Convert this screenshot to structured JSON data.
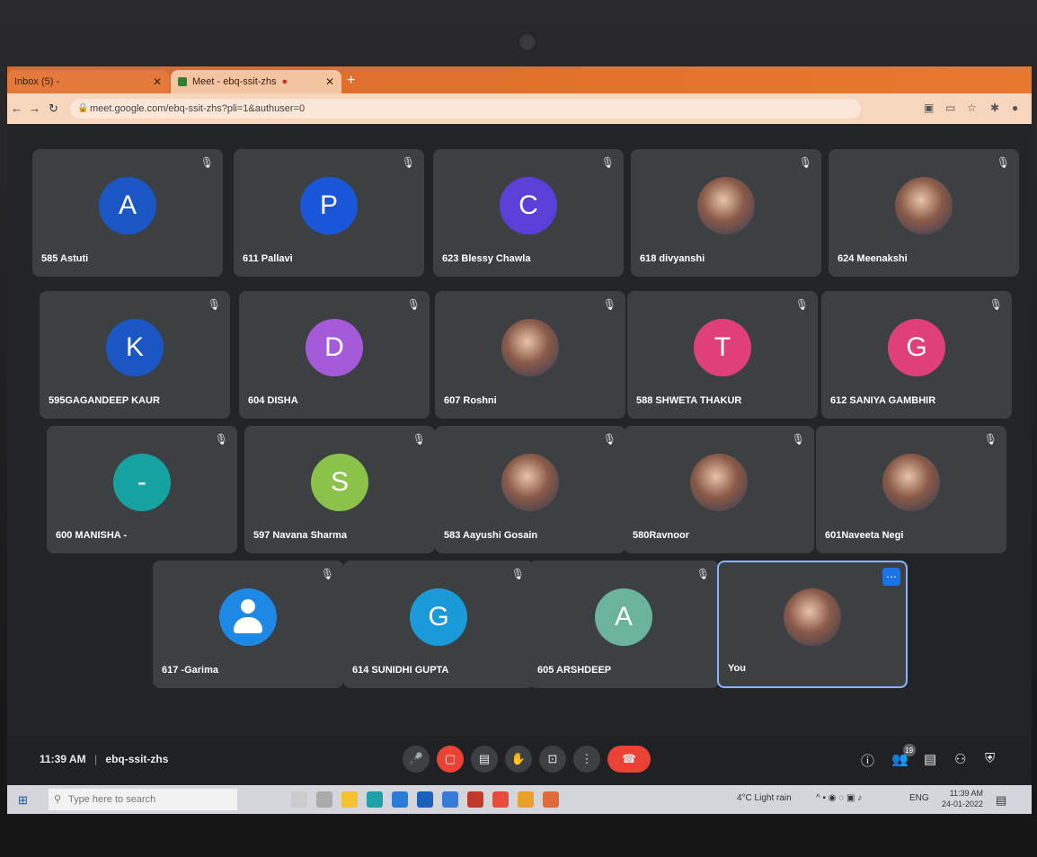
{
  "browser": {
    "tab1_title": "Inbox (5) - ",
    "tab2_title": "Meet - ebq-ssit-zhs",
    "url": "meet.google.com/ebq-ssit-zhs?pli=1&authuser=0"
  },
  "participants": [
    {
      "name": "585 Astuti",
      "initial": "A",
      "color": "#1a56c4",
      "kind": "letter"
    },
    {
      "name": "611 Pallavi",
      "initial": "P",
      "color": "#1a56d8",
      "kind": "letter"
    },
    {
      "name": "623 Blessy Chawla",
      "initial": "C",
      "color": "#5b3fd9",
      "kind": "letter"
    },
    {
      "name": "618 divyanshi",
      "initial": "",
      "color": "#3d6fa8",
      "kind": "photo"
    },
    {
      "name": "624 Meenakshi",
      "initial": "",
      "color": "#b0b8c8",
      "kind": "photo"
    },
    {
      "name": "595GAGANDEEP KAUR",
      "initial": "K",
      "color": "#1a56c4",
      "kind": "letter"
    },
    {
      "name": "604 DISHA",
      "initial": "D",
      "color": "#a55bd9",
      "kind": "letter"
    },
    {
      "name": "607 Roshni",
      "initial": "",
      "color": "#6a4a40",
      "kind": "photo"
    },
    {
      "name": "588 SHWETA THAKUR",
      "initial": "T",
      "color": "#e0407a",
      "kind": "letter"
    },
    {
      "name": "612 SANIYA GAMBHIR",
      "initial": "G",
      "color": "#e0407a",
      "kind": "letter"
    },
    {
      "name": "600 MANISHA -",
      "initial": "-",
      "color": "#17a2a2",
      "kind": "letter"
    },
    {
      "name": "597 Navana Sharma",
      "initial": "S",
      "color": "#8bc34a",
      "kind": "letter"
    },
    {
      "name": "583 Aayushi Gosain",
      "initial": "",
      "color": "#6a4a40",
      "kind": "photo"
    },
    {
      "name": "580Ravnoor",
      "initial": "",
      "color": "#d0b0a0",
      "kind": "photo"
    },
    {
      "name": "601Naveeta Negi",
      "initial": "",
      "color": "#4aa3c8",
      "kind": "photo"
    },
    {
      "name": "617 -Garima",
      "initial": "",
      "color": "#1e88e5",
      "kind": "person"
    },
    {
      "name": "614 SUNIDHI GUPTA",
      "initial": "G",
      "color": "#1a9ad8",
      "kind": "letter"
    },
    {
      "name": "605 ARSHDEEP",
      "initial": "A",
      "color": "#6bb39a",
      "kind": "letter"
    },
    {
      "name": "You",
      "initial": "",
      "color": "#9a5a4a",
      "kind": "you"
    }
  ],
  "meeting": {
    "time": "11:39 AM",
    "code": "ebq-ssit-zhs",
    "people_count": "19"
  },
  "taskbar": {
    "search_placeholder": "Type here to search",
    "weather": "4°C Light rain",
    "clock_time": "11:39 AM",
    "clock_date": "24-01-2022",
    "lang": "ENG"
  }
}
